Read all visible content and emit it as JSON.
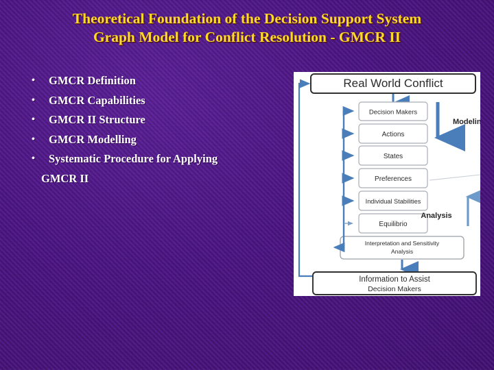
{
  "slide": {
    "title_lines": [
      "Theoretical Foundation of the Decision Support System",
      "Graph Model for Conflict Resolution - GMCR II"
    ],
    "title_color": "#ffd92b",
    "background_color": "#4b1185",
    "bullet_marker": "•",
    "bullets": [
      "GMCR Definition",
      "GMCR Capabilities",
      "GMCR II Structure",
      "GMCR Modelling",
      "Systematic Procedure for Applying"
    ],
    "bullet_continuation": "GMCR  II"
  },
  "diagram": {
    "panel_background": "#ffffff",
    "arrow_color": "#4a7ebb",
    "box_border_color": "#9aa0a6",
    "header_box": "Real World Conflict",
    "footer_box_lines": [
      "Information to Assist",
      "Decision Makers"
    ],
    "stage_boxes": [
      "Decision Makers",
      "Actions",
      "States",
      "Preferences",
      "Individual Stabilities",
      "Equilibrio"
    ],
    "wide_box_lines": [
      "Interpretation and Sensitivity",
      "Analysis"
    ],
    "side_labels": [
      {
        "text": "Modeling",
        "direction": "down"
      },
      {
        "text": "Analysis",
        "direction": "up"
      }
    ]
  }
}
